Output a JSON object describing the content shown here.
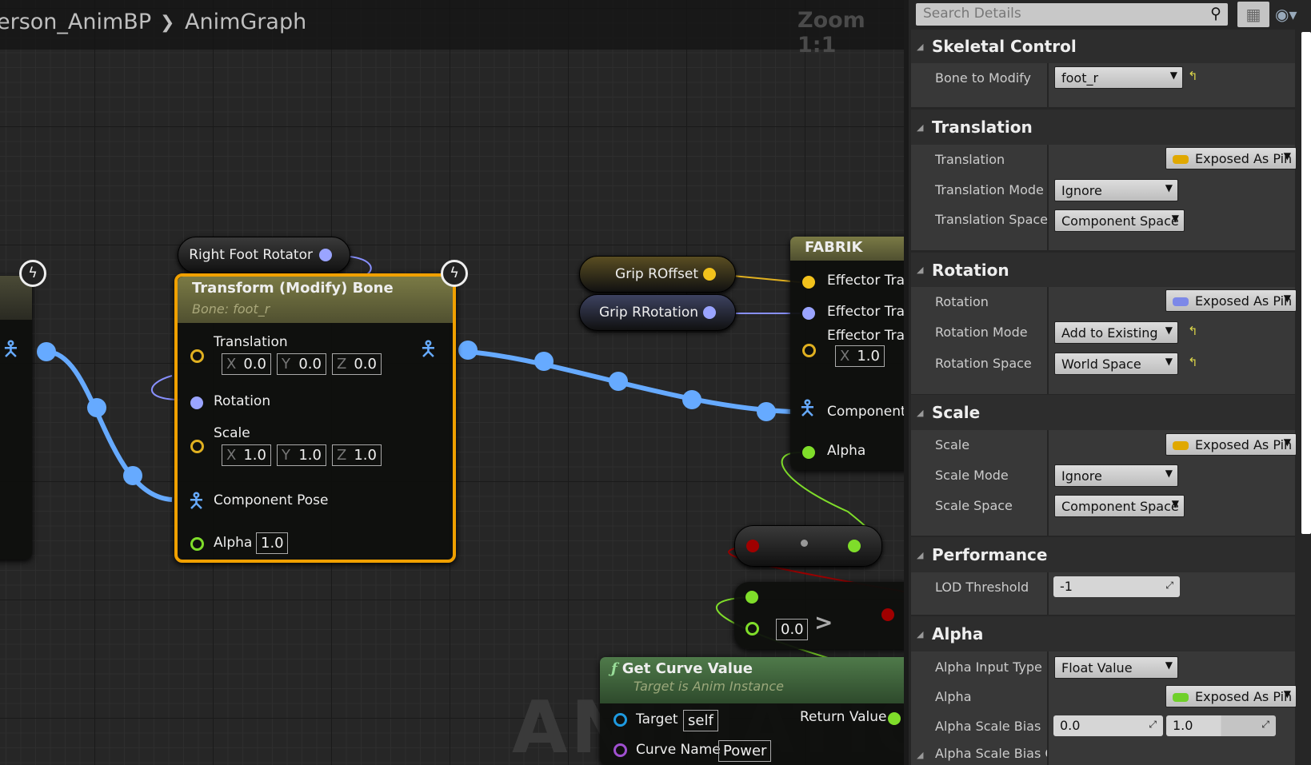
{
  "breadcrumb": {
    "items": [
      "erson_AnimBP",
      "AnimGraph"
    ],
    "separator": "❯"
  },
  "zoom_label": "Zoom 1:1",
  "watermark": "ANIMATION",
  "nodes": {
    "transform": {
      "title": "Transform (Modify) Bone",
      "subtitle": "Bone: foot_r",
      "pins": {
        "translation": "Translation",
        "rotation": "Rotation",
        "scale": "Scale",
        "component_pose": "Component Pose",
        "alpha": "Alpha"
      },
      "translation": {
        "x": "0.0",
        "y": "0.0",
        "z": "0.0"
      },
      "scale": {
        "x": "1.0",
        "y": "1.0",
        "z": "1.0"
      },
      "alpha_value": "1.0",
      "axis": {
        "x": "X",
        "y": "Y",
        "z": "Z"
      }
    },
    "right_foot_rotator": "Right Foot Rotator",
    "grip_roffset": "Grip ROffset",
    "grip_rrotation": "Grip RRotation",
    "fabrik": {
      "title": "FABRIK",
      "pins": [
        "Effector Tra",
        "Effector Tra",
        "Effector Tra",
        "Component",
        "Alpha"
      ],
      "x_label": "X",
      "x_value": "1.0"
    },
    "compare": {
      "value": "0.0",
      "operator": ">"
    },
    "get_curve": {
      "title": "Get Curve Value",
      "subtitle": "Target is Anim Instance",
      "target_label": "Target",
      "target_value": "self",
      "return_label": "Return Value",
      "curve_name_label": "Curve Name",
      "curve_name_value": "Power"
    }
  },
  "colors": {
    "accent_select": "#f0a000",
    "vector_pin": "#f2c21c",
    "rotator_pin": "#9aa4ff",
    "float_pin": "#7fdd2a",
    "pose_wire": "#66aaff",
    "bool_pin": "#a00000"
  },
  "details": {
    "search_placeholder": "Search Details",
    "icons": {
      "search": "search-icon",
      "view": "list-grid-icon",
      "eye": "eye-icon",
      "reset": "reset-arrow-icon"
    },
    "sections": {
      "skeletal": {
        "title": "Skeletal Control",
        "bone_label": "Bone to Modify",
        "bone_value": "foot_r"
      },
      "translation": {
        "title": "Translation",
        "translation_label": "Translation",
        "translation_value": "Exposed As Pin",
        "mode_label": "Translation Mode",
        "mode_value": "Ignore",
        "space_label": "Translation Space",
        "space_value": "Component Space"
      },
      "rotation": {
        "title": "Rotation",
        "rotation_label": "Rotation",
        "rotation_value": "Exposed As Pin",
        "mode_label": "Rotation Mode",
        "mode_value": "Add to Existing",
        "space_label": "Rotation Space",
        "space_value": "World Space"
      },
      "scale": {
        "title": "Scale",
        "scale_label": "Scale",
        "scale_value": "Exposed As Pin",
        "mode_label": "Scale Mode",
        "mode_value": "Ignore",
        "space_label": "Scale Space",
        "space_value": "Component Space"
      },
      "performance": {
        "title": "Performance",
        "lod_label": "LOD Threshold",
        "lod_value": "-1"
      },
      "alpha": {
        "title": "Alpha",
        "input_type_label": "Alpha Input Type",
        "input_type_value": "Float Value",
        "alpha_label": "Alpha",
        "alpha_value": "Exposed As Pin",
        "bias_label": "Alpha Scale Bias",
        "bias_min": "0.0",
        "bias_max": "1.0",
        "clamp_label": "Alpha Scale Bias Cla"
      }
    }
  }
}
